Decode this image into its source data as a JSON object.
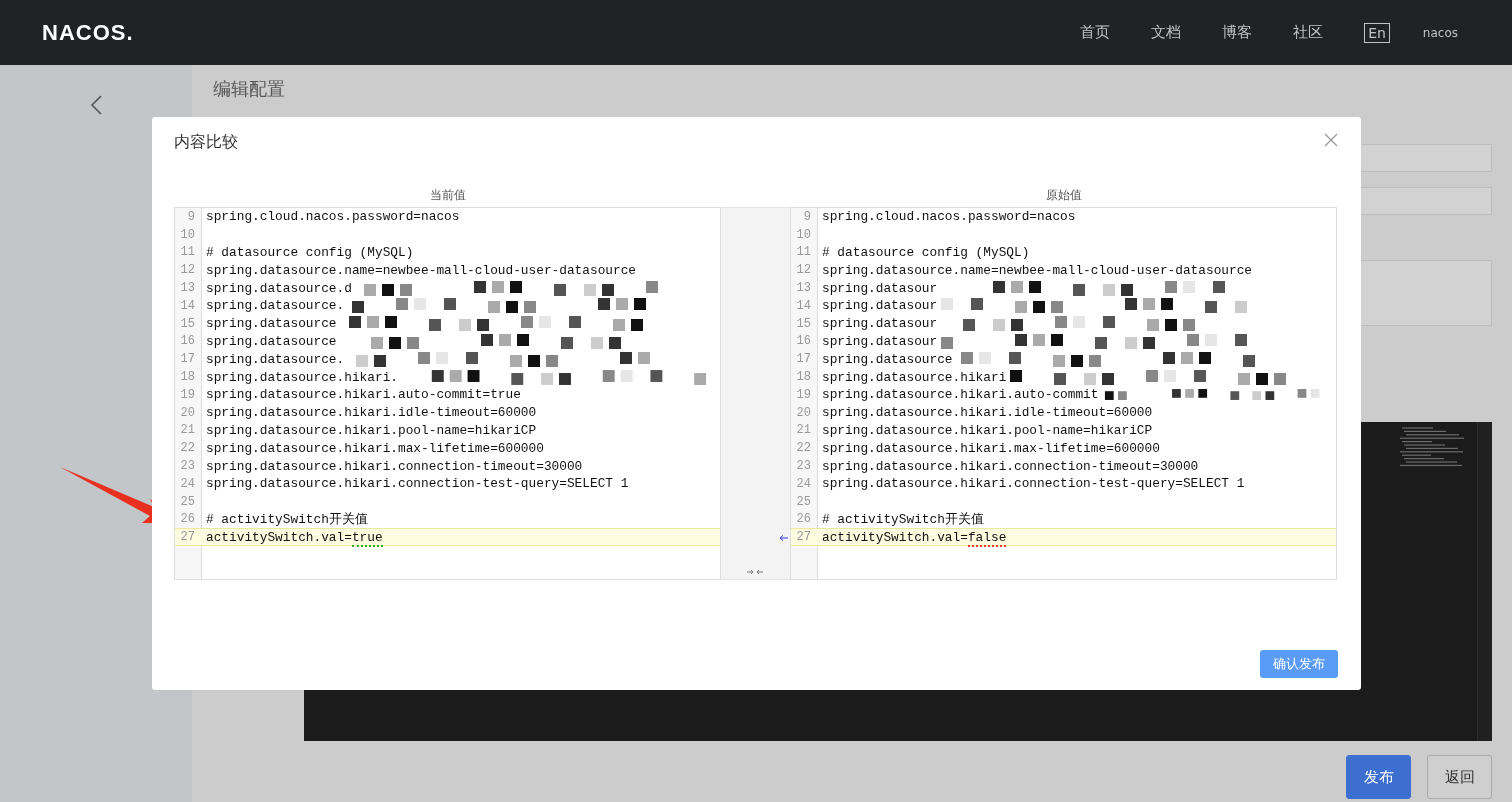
{
  "header": {
    "logo": "NACOS.",
    "nav": [
      "首页",
      "文档",
      "博客",
      "社区"
    ],
    "lang": "En",
    "user": "nacos"
  },
  "page": {
    "title": "编辑配置",
    "buttons": [
      {
        "label": "发布",
        "kind": "primary"
      },
      {
        "label": "返回",
        "kind": "normal"
      }
    ]
  },
  "dialog": {
    "title": "内容比较",
    "confirm": "确认发布",
    "panes": [
      {
        "heading": "当前值",
        "lines": [
          {
            "num": "9",
            "text": "spring.cloud.nacos.password=nacos",
            "changed": false,
            "redacted": false
          },
          {
            "num": "10",
            "changed": false,
            "redacted": false
          },
          {
            "num": "11",
            "text": "# datasource config (MySQL)",
            "changed": false,
            "redacted": false
          },
          {
            "num": "12",
            "text": "spring.datasource.name=newbee-mall-cloud-user-datasource",
            "changed": false,
            "redacted": false
          },
          {
            "num": "13",
            "text": "spring.datasource.d",
            "changed": false,
            "redacted": true
          },
          {
            "num": "14",
            "text": "spring.datasource.",
            "changed": false,
            "redacted": true
          },
          {
            "num": "15",
            "text": "spring.datasource",
            "changed": false,
            "redacted": true
          },
          {
            "num": "16",
            "text": "spring.datasource",
            "changed": false,
            "redacted": true
          },
          {
            "num": "17",
            "text": "spring.datasource.",
            "changed": false,
            "redacted": true
          },
          {
            "num": "18",
            "text": "spring.datasource.hikari.",
            "changed": false,
            "redacted": true
          },
          {
            "num": "19",
            "text": "spring.datasource.hikari.auto-commit=true",
            "changed": false,
            "redacted": false
          },
          {
            "num": "20",
            "text": "spring.datasource.hikari.idle-timeout=60000",
            "changed": false,
            "redacted": false
          },
          {
            "num": "21",
            "text": "spring.datasource.hikari.pool-name=hikariCP",
            "changed": false,
            "redacted": false
          },
          {
            "num": "22",
            "text": "spring.datasource.hikari.max-lifetime=600000",
            "changed": false,
            "redacted": false
          },
          {
            "num": "23",
            "text": "spring.datasource.hikari.connection-timeout=30000",
            "changed": false,
            "redacted": false
          },
          {
            "num": "24",
            "text": "spring.datasource.hikari.connection-test-query=SELECT 1",
            "changed": false,
            "redacted": false
          },
          {
            "num": "25",
            "changed": false,
            "redacted": false
          },
          {
            "num": "26",
            "text": "# activitySwitch开关值",
            "changed": false,
            "redacted": false
          },
          {
            "num": "27",
            "text": "activitySwitch.val=",
            "diff": "true",
            "changed": true,
            "redacted": false
          }
        ]
      },
      {
        "heading": "原始值",
        "lines": [
          {
            "num": "9",
            "text": "spring.cloud.nacos.password=nacos",
            "changed": false,
            "redacted": false
          },
          {
            "num": "10",
            "changed": false,
            "redacted": false
          },
          {
            "num": "11",
            "text": "# datasource config (MySQL)",
            "changed": false,
            "redacted": false
          },
          {
            "num": "12",
            "text": "spring.datasource.name=newbee-mall-cloud-user-datasource",
            "changed": false,
            "redacted": false
          },
          {
            "num": "13",
            "text": "spring.datasour",
            "changed": false,
            "redacted": true
          },
          {
            "num": "14",
            "text": "spring.datasour",
            "changed": false,
            "redacted": true
          },
          {
            "num": "15",
            "text": "spring.datasour",
            "changed": false,
            "redacted": true
          },
          {
            "num": "16",
            "text": "spring.datasour",
            "changed": false,
            "redacted": true
          },
          {
            "num": "17",
            "text": "spring.datasource",
            "changed": false,
            "redacted": true
          },
          {
            "num": "18",
            "text": "spring.datasource.hikari",
            "changed": false,
            "redacted": true
          },
          {
            "num": "19",
            "text": "spring.datasource.hikari.auto-commit",
            "changed": false,
            "redacted": true
          },
          {
            "num": "20",
            "text": "spring.datasource.hikari.idle-timeout=60000",
            "changed": false,
            "redacted": false
          },
          {
            "num": "21",
            "text": "spring.datasource.hikari.pool-name=hikariCP",
            "changed": false,
            "redacted": false
          },
          {
            "num": "22",
            "text": "spring.datasource.hikari.max-lifetime=600000",
            "changed": false,
            "redacted": false
          },
          {
            "num": "23",
            "text": "spring.datasource.hikari.connection-timeout=30000",
            "changed": false,
            "redacted": false
          },
          {
            "num": "24",
            "text": "spring.datasource.hikari.connection-test-query=SELECT 1",
            "changed": false,
            "redacted": false
          },
          {
            "num": "25",
            "changed": false,
            "redacted": false
          },
          {
            "num": "26",
            "text": "# activitySwitch开关值",
            "changed": false,
            "redacted": false
          },
          {
            "num": "27",
            "text": "activitySwitch.val=",
            "diff": "false",
            "changed": true,
            "redacted": false
          }
        ]
      }
    ]
  }
}
